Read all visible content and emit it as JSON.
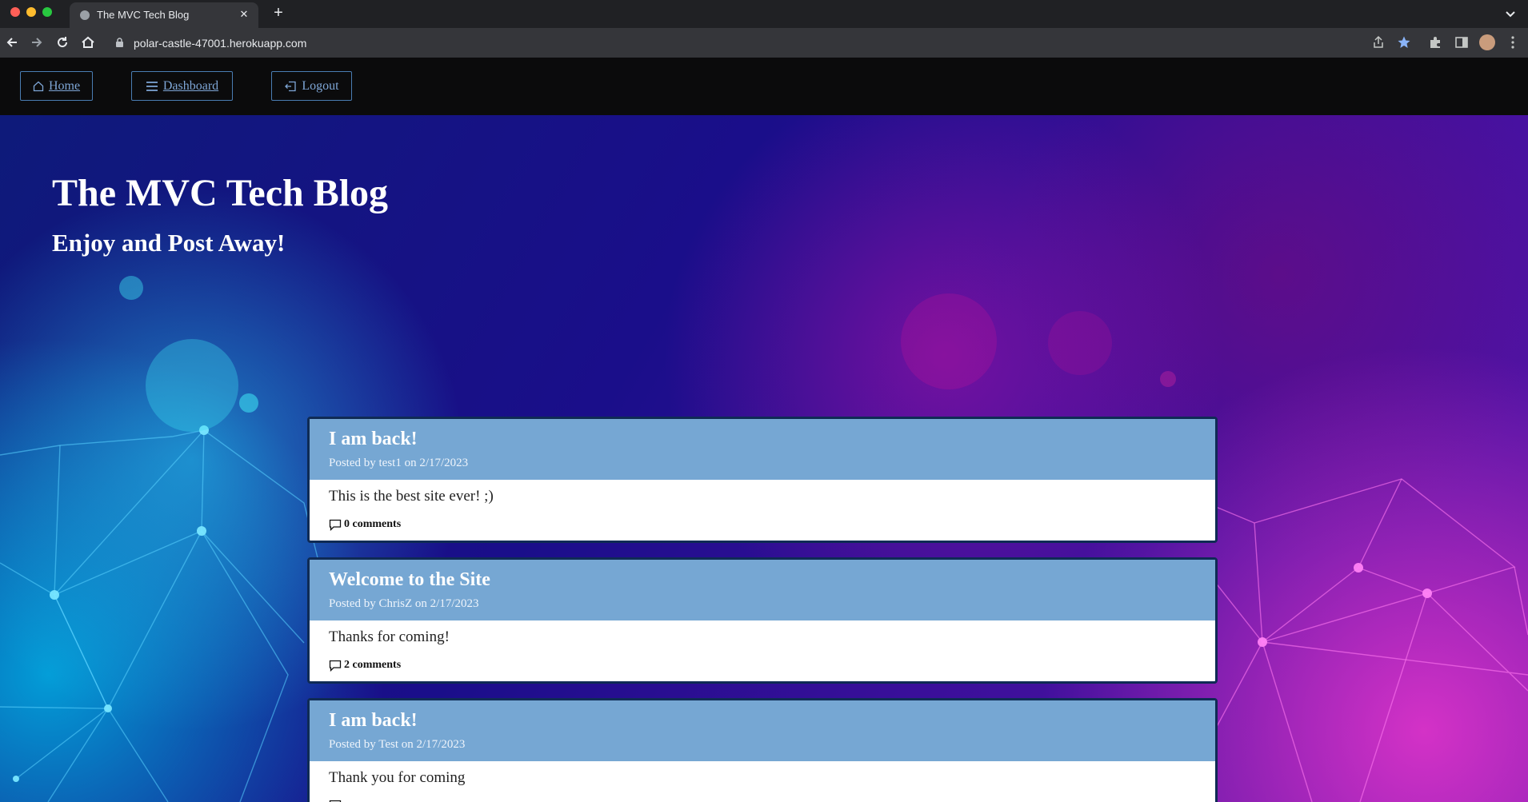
{
  "browser": {
    "tab_title": "The MVC Tech Blog",
    "url": "polar-castle-47001.herokuapp.com"
  },
  "nav": {
    "home": "Home",
    "dashboard": "Dashboard",
    "logout": "Logout"
  },
  "hero": {
    "title": "The MVC Tech Blog",
    "subtitle": "Enjoy and Post Away!"
  },
  "posts": [
    {
      "title": "I am back!",
      "meta": "Posted by test1 on 2/17/2023",
      "content": "This is the best site ever! ;)",
      "comments": "0 comments"
    },
    {
      "title": "Welcome to the Site",
      "meta": "Posted by ChrisZ on 2/17/2023",
      "content": "Thanks for coming!",
      "comments": "2 comments"
    },
    {
      "title": "I am back!",
      "meta": "Posted by Test on 2/17/2023",
      "content": "Thank you for coming",
      "comments": ""
    }
  ],
  "colors": {
    "nav_bg": "#0b0b0c",
    "nav_link": "#7ea6d6",
    "post_header": "#76a7d3",
    "post_border": "#0f2b55"
  }
}
